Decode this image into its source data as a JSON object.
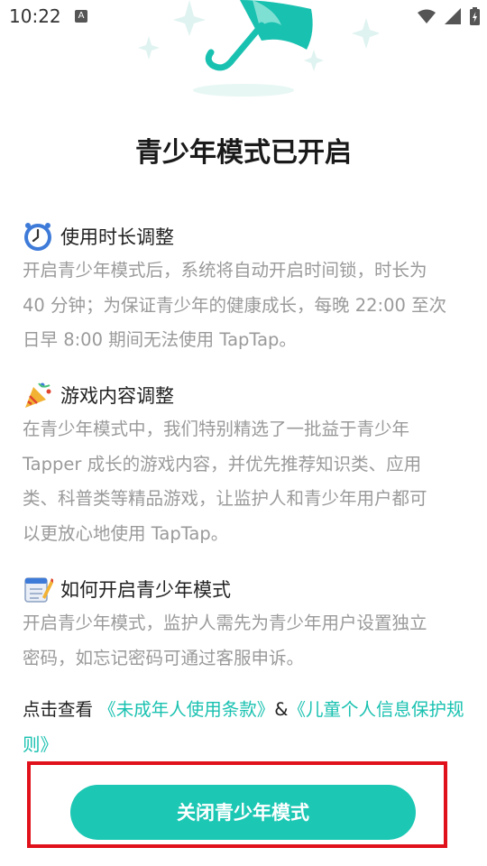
{
  "status_bar": {
    "time": "10:22",
    "notif_glyph": "A"
  },
  "page": {
    "title": "青少年模式已开启"
  },
  "sections": [
    {
      "icon": "clock-icon",
      "title": "使用时长调整",
      "lines": [
        "开启青少年模式后，系统将自动开启时间锁，时长为",
        "40 分钟；为保证青少年的健康成长，每晚 22:00 至次",
        "日早 8:00 期间无法使用 TapTap。"
      ]
    },
    {
      "icon": "party-popper-icon",
      "title": "游戏内容调整",
      "lines": [
        "在青少年模式中，我们特别精选了一批益于青少年",
        "Tapper 成长的游戏内容，并优先推荐知识类、应用",
        "类、科普类等精品游戏，让监护人和青少年用户都可",
        "以更放心地使用 TapTap。"
      ]
    },
    {
      "icon": "notepad-icon",
      "title": "如何开启青少年模式",
      "lines": [
        "开启青少年模式，监护人需先为青少年用户设置独立",
        "密码，如忘记密码可通过客服申诉。"
      ]
    }
  ],
  "terms": {
    "prefix": "点击查看 ",
    "link1": "《未成年人使用条款》",
    "separator": "&",
    "link2": "《儿童个人信息保护规则》"
  },
  "actions": {
    "close_button": "关闭青少年模式"
  },
  "colors": {
    "accent": "#1cc7b4",
    "highlight_border": "#e0111b",
    "body_text": "#9a9a9a"
  }
}
